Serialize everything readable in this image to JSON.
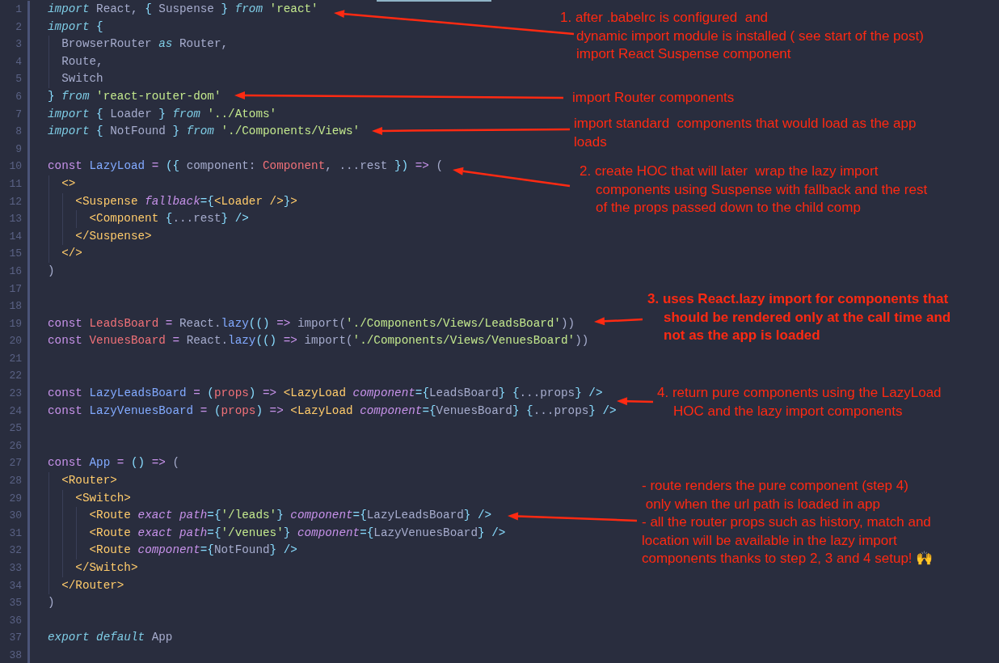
{
  "editor": {
    "lines": [
      {
        "number": "1",
        "tokens": [
          {
            "kind": "kw",
            "text": "import"
          },
          {
            "kind": "plain",
            "text": " React, "
          },
          {
            "kind": "punct",
            "text": "{"
          },
          {
            "kind": "plain",
            "text": " Suspense "
          },
          {
            "kind": "punct",
            "text": "}"
          },
          {
            "kind": "kw",
            "text": " from"
          },
          {
            "kind": "str",
            "text": " 'react'"
          }
        ]
      },
      {
        "number": "2",
        "tokens": [
          {
            "kind": "kw",
            "text": "import"
          },
          {
            "kind": "punct",
            "text": " {"
          }
        ]
      },
      {
        "number": "3",
        "tokens": [
          {
            "kind": "plain",
            "text": "  BrowserRouter "
          },
          {
            "kind": "kw",
            "text": "as"
          },
          {
            "kind": "plain",
            "text": " Router,"
          }
        ]
      },
      {
        "number": "4",
        "tokens": [
          {
            "kind": "plain",
            "text": "  Route,"
          }
        ]
      },
      {
        "number": "5",
        "tokens": [
          {
            "kind": "plain",
            "text": "  Switch"
          }
        ]
      },
      {
        "number": "6",
        "tokens": [
          {
            "kind": "punct",
            "text": "}"
          },
          {
            "kind": "kw",
            "text": " from"
          },
          {
            "kind": "str",
            "text": " 'react-router-dom'"
          }
        ]
      },
      {
        "number": "7",
        "tokens": [
          {
            "kind": "kw",
            "text": "import"
          },
          {
            "kind": "punct",
            "text": " {"
          },
          {
            "kind": "plain",
            "text": " Loader "
          },
          {
            "kind": "punct",
            "text": "}"
          },
          {
            "kind": "kw",
            "text": " from"
          },
          {
            "kind": "str",
            "text": " '../Atoms'"
          }
        ]
      },
      {
        "number": "8",
        "tokens": [
          {
            "kind": "kw",
            "text": "import"
          },
          {
            "kind": "punct",
            "text": " {"
          },
          {
            "kind": "plain",
            "text": " NotFound "
          },
          {
            "kind": "punct",
            "text": "}"
          },
          {
            "kind": "kw",
            "text": " from"
          },
          {
            "kind": "str",
            "text": " './Components/Views'"
          }
        ]
      },
      {
        "number": "9"
      },
      {
        "number": "10",
        "tokens": [
          {
            "kind": "storage",
            "text": "const"
          },
          {
            "kind": "fn",
            "text": " LazyLoad"
          },
          {
            "kind": "op",
            "text": " ="
          },
          {
            "kind": "punct",
            "text": " ({"
          },
          {
            "kind": "plain",
            "text": " component: "
          },
          {
            "kind": "var",
            "text": "Component"
          },
          {
            "kind": "plain",
            "text": ", ...rest "
          },
          {
            "kind": "punct",
            "text": "})"
          },
          {
            "kind": "op",
            "text": " =>"
          },
          {
            "kind": "plain",
            "text": " ("
          }
        ]
      },
      {
        "number": "11",
        "tokens": [
          {
            "kind": "tag",
            "text": "  <>"
          }
        ]
      },
      {
        "number": "12",
        "tokens": [
          {
            "kind": "tag",
            "text": "    <Suspense"
          },
          {
            "kind": "attr",
            "text": " fallback"
          },
          {
            "kind": "punct",
            "text": "={"
          },
          {
            "kind": "tag",
            "text": "<Loader />"
          },
          {
            "kind": "punct",
            "text": "}"
          },
          {
            "kind": "tag",
            "text": ">"
          }
        ]
      },
      {
        "number": "13",
        "tokens": [
          {
            "kind": "tag",
            "text": "      <Component"
          },
          {
            "kind": "punct",
            "text": " {"
          },
          {
            "kind": "plain",
            "text": "...rest"
          },
          {
            "kind": "punct",
            "text": "}"
          },
          {
            "kind": "punct",
            "text": " />"
          }
        ]
      },
      {
        "number": "14",
        "tokens": [
          {
            "kind": "tag",
            "text": "    </Suspense>"
          }
        ]
      },
      {
        "number": "15",
        "tokens": [
          {
            "kind": "tag",
            "text": "  </>"
          }
        ]
      },
      {
        "number": "16",
        "tokens": [
          {
            "kind": "plain",
            "text": ")"
          }
        ]
      },
      {
        "number": "17"
      },
      {
        "number": "18"
      },
      {
        "number": "19",
        "tokens": [
          {
            "kind": "storage",
            "text": "const"
          },
          {
            "kind": "var",
            "text": " LeadsBoard"
          },
          {
            "kind": "op",
            "text": " ="
          },
          {
            "kind": "plain",
            "text": " React."
          },
          {
            "kind": "fn",
            "text": "lazy"
          },
          {
            "kind": "punct",
            "text": "(()"
          },
          {
            "kind": "op",
            "text": " =>"
          },
          {
            "kind": "plain",
            "text": " import("
          },
          {
            "kind": "str",
            "text": "'./Components/Views/LeadsBoard'"
          },
          {
            "kind": "plain",
            "text": "))"
          }
        ]
      },
      {
        "number": "20",
        "tokens": [
          {
            "kind": "storage",
            "text": "const"
          },
          {
            "kind": "var",
            "text": " VenuesBoard"
          },
          {
            "kind": "op",
            "text": " ="
          },
          {
            "kind": "plain",
            "text": " React."
          },
          {
            "kind": "fn",
            "text": "lazy"
          },
          {
            "kind": "punct",
            "text": "(()"
          },
          {
            "kind": "op",
            "text": " =>"
          },
          {
            "kind": "plain",
            "text": " import("
          },
          {
            "kind": "str",
            "text": "'./Components/Views/VenuesBoard'"
          },
          {
            "kind": "plain",
            "text": "))"
          }
        ]
      },
      {
        "number": "21"
      },
      {
        "number": "22"
      },
      {
        "number": "23",
        "tokens": [
          {
            "kind": "storage",
            "text": "const"
          },
          {
            "kind": "fn",
            "text": " LazyLeadsBoard"
          },
          {
            "kind": "op",
            "text": " ="
          },
          {
            "kind": "punct",
            "text": " ("
          },
          {
            "kind": "var",
            "text": "props"
          },
          {
            "kind": "punct",
            "text": ")"
          },
          {
            "kind": "op",
            "text": " =>"
          },
          {
            "kind": "tag",
            "text": " <LazyLoad"
          },
          {
            "kind": "attr",
            "text": " component"
          },
          {
            "kind": "punct",
            "text": "={"
          },
          {
            "kind": "plain",
            "text": "LeadsBoard"
          },
          {
            "kind": "punct",
            "text": "}"
          },
          {
            "kind": "punct",
            "text": " {"
          },
          {
            "kind": "plain",
            "text": "...props"
          },
          {
            "kind": "punct",
            "text": "}"
          },
          {
            "kind": "punct",
            "text": " />"
          }
        ]
      },
      {
        "number": "24",
        "tokens": [
          {
            "kind": "storage",
            "text": "const"
          },
          {
            "kind": "fn",
            "text": " LazyVenuesBoard"
          },
          {
            "kind": "op",
            "text": " ="
          },
          {
            "kind": "punct",
            "text": " ("
          },
          {
            "kind": "var",
            "text": "props"
          },
          {
            "kind": "punct",
            "text": ")"
          },
          {
            "kind": "op",
            "text": " =>"
          },
          {
            "kind": "tag",
            "text": " <LazyLoad"
          },
          {
            "kind": "attr",
            "text": " component"
          },
          {
            "kind": "punct",
            "text": "={"
          },
          {
            "kind": "plain",
            "text": "VenuesBoard"
          },
          {
            "kind": "punct",
            "text": "}"
          },
          {
            "kind": "punct",
            "text": " {"
          },
          {
            "kind": "plain",
            "text": "...props"
          },
          {
            "kind": "punct",
            "text": "}"
          },
          {
            "kind": "punct",
            "text": " />"
          }
        ]
      },
      {
        "number": "25"
      },
      {
        "number": "26"
      },
      {
        "number": "27",
        "tokens": [
          {
            "kind": "storage",
            "text": "const"
          },
          {
            "kind": "fn",
            "text": " App"
          },
          {
            "kind": "op",
            "text": " ="
          },
          {
            "kind": "punct",
            "text": " ()"
          },
          {
            "kind": "op",
            "text": " =>"
          },
          {
            "kind": "plain",
            "text": " ("
          }
        ]
      },
      {
        "number": "28",
        "tokens": [
          {
            "kind": "tag",
            "text": "  <Router>"
          }
        ]
      },
      {
        "number": "29",
        "tokens": [
          {
            "kind": "tag",
            "text": "    <Switch>"
          }
        ]
      },
      {
        "number": "30",
        "tokens": [
          {
            "kind": "tag",
            "text": "      <Route"
          },
          {
            "kind": "attr",
            "text": " exact path"
          },
          {
            "kind": "punct",
            "text": "={"
          },
          {
            "kind": "str",
            "text": "'/leads'"
          },
          {
            "kind": "punct",
            "text": "}"
          },
          {
            "kind": "attr",
            "text": " component"
          },
          {
            "kind": "punct",
            "text": "={"
          },
          {
            "kind": "plain",
            "text": "LazyLeadsBoard"
          },
          {
            "kind": "punct",
            "text": "}"
          },
          {
            "kind": "punct",
            "text": " />"
          }
        ]
      },
      {
        "number": "31",
        "tokens": [
          {
            "kind": "tag",
            "text": "      <Route"
          },
          {
            "kind": "attr",
            "text": " exact path"
          },
          {
            "kind": "punct",
            "text": "={"
          },
          {
            "kind": "str",
            "text": "'/venues'"
          },
          {
            "kind": "punct",
            "text": "}"
          },
          {
            "kind": "attr",
            "text": " component"
          },
          {
            "kind": "punct",
            "text": "={"
          },
          {
            "kind": "plain",
            "text": "LazyVenuesBoard"
          },
          {
            "kind": "punct",
            "text": "}"
          },
          {
            "kind": "punct",
            "text": " />"
          }
        ]
      },
      {
        "number": "32",
        "tokens": [
          {
            "kind": "tag",
            "text": "      <Route"
          },
          {
            "kind": "attr",
            "text": " component"
          },
          {
            "kind": "punct",
            "text": "={"
          },
          {
            "kind": "plain",
            "text": "NotFound"
          },
          {
            "kind": "punct",
            "text": "}"
          },
          {
            "kind": "punct",
            "text": " />"
          }
        ]
      },
      {
        "number": "33",
        "tokens": [
          {
            "kind": "tag",
            "text": "    </Switch>"
          }
        ]
      },
      {
        "number": "34",
        "tokens": [
          {
            "kind": "tag",
            "text": "  </Router>"
          }
        ]
      },
      {
        "number": "35",
        "tokens": [
          {
            "kind": "plain",
            "text": ")"
          }
        ]
      },
      {
        "number": "36"
      },
      {
        "number": "37",
        "tokens": [
          {
            "kind": "kw",
            "text": "export default"
          },
          {
            "kind": "plain",
            "text": " App"
          }
        ]
      },
      {
        "number": "38"
      }
    ]
  },
  "annotations": [
    {
      "kind": "step",
      "bold": false,
      "lines": [
        "1. after .babelrc is configured  and",
        "dynamic import module is installed ( see start of the post)",
        "import React Suspense component"
      ]
    },
    {
      "kind": "note",
      "bold": false,
      "lines": [
        "import Router components"
      ]
    },
    {
      "kind": "note",
      "bold": false,
      "lines": [
        "import standard  components that would load as the app",
        "loads"
      ]
    },
    {
      "kind": "step",
      "bold": false,
      "lines": [
        "2. create HOC that will later  wrap the lazy import",
        "components using Suspense with fallback and the rest",
        "of the props passed down to the child comp"
      ]
    },
    {
      "kind": "step",
      "bold": true,
      "lines": [
        "3. uses React.lazy import for components that",
        "should be rendered only at the call time and",
        "not as the app is loaded"
      ]
    },
    {
      "kind": "step",
      "bold": false,
      "lines": [
        "4. return pure components using the LazyLoad",
        "HOC and the lazy import components"
      ]
    },
    {
      "kind": "note",
      "bold": false,
      "lines": [
        "- route renders the pure component (step 4)",
        " only when the url path is loaded in app",
        "- all the router props such as history, match and",
        "location will be available in the lazy import",
        "components thanks to step 2, 3 and 4 setup! 🙌"
      ]
    }
  ]
}
